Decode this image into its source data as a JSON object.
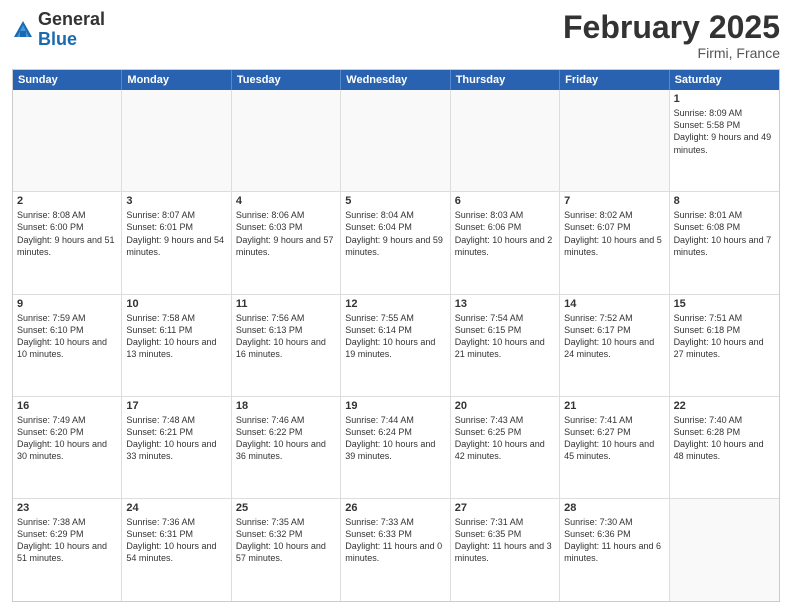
{
  "header": {
    "logo_general": "General",
    "logo_blue": "Blue",
    "month_title": "February 2025",
    "location": "Firmi, France"
  },
  "weekdays": [
    "Sunday",
    "Monday",
    "Tuesday",
    "Wednesday",
    "Thursday",
    "Friday",
    "Saturday"
  ],
  "weeks": [
    [
      {
        "day": "",
        "info": ""
      },
      {
        "day": "",
        "info": ""
      },
      {
        "day": "",
        "info": ""
      },
      {
        "day": "",
        "info": ""
      },
      {
        "day": "",
        "info": ""
      },
      {
        "day": "",
        "info": ""
      },
      {
        "day": "1",
        "info": "Sunrise: 8:09 AM\nSunset: 5:58 PM\nDaylight: 9 hours\nand 49 minutes."
      }
    ],
    [
      {
        "day": "2",
        "info": "Sunrise: 8:08 AM\nSunset: 6:00 PM\nDaylight: 9 hours\nand 51 minutes."
      },
      {
        "day": "3",
        "info": "Sunrise: 8:07 AM\nSunset: 6:01 PM\nDaylight: 9 hours\nand 54 minutes."
      },
      {
        "day": "4",
        "info": "Sunrise: 8:06 AM\nSunset: 6:03 PM\nDaylight: 9 hours\nand 57 minutes."
      },
      {
        "day": "5",
        "info": "Sunrise: 8:04 AM\nSunset: 6:04 PM\nDaylight: 9 hours\nand 59 minutes."
      },
      {
        "day": "6",
        "info": "Sunrise: 8:03 AM\nSunset: 6:06 PM\nDaylight: 10 hours\nand 2 minutes."
      },
      {
        "day": "7",
        "info": "Sunrise: 8:02 AM\nSunset: 6:07 PM\nDaylight: 10 hours\nand 5 minutes."
      },
      {
        "day": "8",
        "info": "Sunrise: 8:01 AM\nSunset: 6:08 PM\nDaylight: 10 hours\nand 7 minutes."
      }
    ],
    [
      {
        "day": "9",
        "info": "Sunrise: 7:59 AM\nSunset: 6:10 PM\nDaylight: 10 hours\nand 10 minutes."
      },
      {
        "day": "10",
        "info": "Sunrise: 7:58 AM\nSunset: 6:11 PM\nDaylight: 10 hours\nand 13 minutes."
      },
      {
        "day": "11",
        "info": "Sunrise: 7:56 AM\nSunset: 6:13 PM\nDaylight: 10 hours\nand 16 minutes."
      },
      {
        "day": "12",
        "info": "Sunrise: 7:55 AM\nSunset: 6:14 PM\nDaylight: 10 hours\nand 19 minutes."
      },
      {
        "day": "13",
        "info": "Sunrise: 7:54 AM\nSunset: 6:15 PM\nDaylight: 10 hours\nand 21 minutes."
      },
      {
        "day": "14",
        "info": "Sunrise: 7:52 AM\nSunset: 6:17 PM\nDaylight: 10 hours\nand 24 minutes."
      },
      {
        "day": "15",
        "info": "Sunrise: 7:51 AM\nSunset: 6:18 PM\nDaylight: 10 hours\nand 27 minutes."
      }
    ],
    [
      {
        "day": "16",
        "info": "Sunrise: 7:49 AM\nSunset: 6:20 PM\nDaylight: 10 hours\nand 30 minutes."
      },
      {
        "day": "17",
        "info": "Sunrise: 7:48 AM\nSunset: 6:21 PM\nDaylight: 10 hours\nand 33 minutes."
      },
      {
        "day": "18",
        "info": "Sunrise: 7:46 AM\nSunset: 6:22 PM\nDaylight: 10 hours\nand 36 minutes."
      },
      {
        "day": "19",
        "info": "Sunrise: 7:44 AM\nSunset: 6:24 PM\nDaylight: 10 hours\nand 39 minutes."
      },
      {
        "day": "20",
        "info": "Sunrise: 7:43 AM\nSunset: 6:25 PM\nDaylight: 10 hours\nand 42 minutes."
      },
      {
        "day": "21",
        "info": "Sunrise: 7:41 AM\nSunset: 6:27 PM\nDaylight: 10 hours\nand 45 minutes."
      },
      {
        "day": "22",
        "info": "Sunrise: 7:40 AM\nSunset: 6:28 PM\nDaylight: 10 hours\nand 48 minutes."
      }
    ],
    [
      {
        "day": "23",
        "info": "Sunrise: 7:38 AM\nSunset: 6:29 PM\nDaylight: 10 hours\nand 51 minutes."
      },
      {
        "day": "24",
        "info": "Sunrise: 7:36 AM\nSunset: 6:31 PM\nDaylight: 10 hours\nand 54 minutes."
      },
      {
        "day": "25",
        "info": "Sunrise: 7:35 AM\nSunset: 6:32 PM\nDaylight: 10 hours\nand 57 minutes."
      },
      {
        "day": "26",
        "info": "Sunrise: 7:33 AM\nSunset: 6:33 PM\nDaylight: 11 hours\nand 0 minutes."
      },
      {
        "day": "27",
        "info": "Sunrise: 7:31 AM\nSunset: 6:35 PM\nDaylight: 11 hours\nand 3 minutes."
      },
      {
        "day": "28",
        "info": "Sunrise: 7:30 AM\nSunset: 6:36 PM\nDaylight: 11 hours\nand 6 minutes."
      },
      {
        "day": "",
        "info": ""
      }
    ]
  ]
}
